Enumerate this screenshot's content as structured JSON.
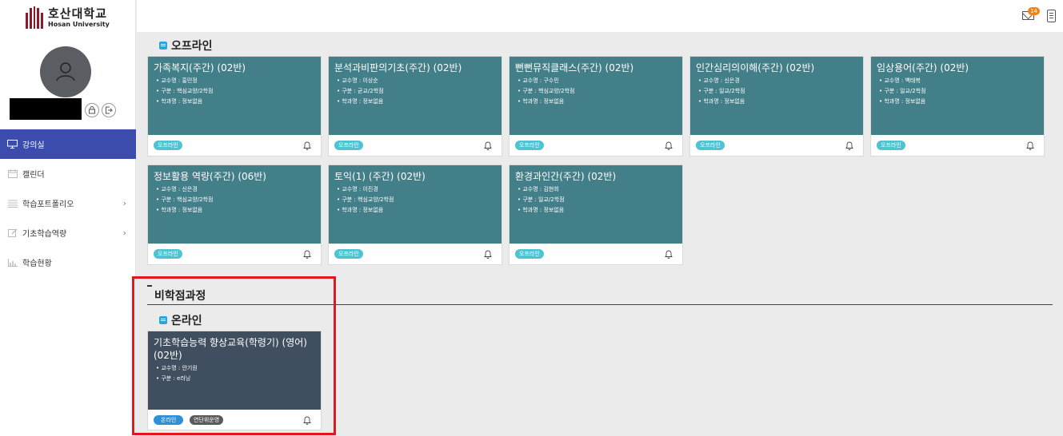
{
  "logo": {
    "name_ko": "호산대학교",
    "name_en": "Hosan University"
  },
  "sidebar": {
    "items": [
      {
        "label": "강의실",
        "icon": "monitor-icon",
        "active": true
      },
      {
        "label": "캘린더",
        "icon": "calendar-icon"
      },
      {
        "label": "학습포트폴리오",
        "icon": "list-icon",
        "chevron": true
      },
      {
        "label": "기초학습역량",
        "icon": "edit-icon",
        "chevron": true
      },
      {
        "label": "학습현황",
        "icon": "bar-chart-icon"
      }
    ]
  },
  "topbar": {
    "mail_badge": "14"
  },
  "offline_section": {
    "title": "오프라인"
  },
  "courses": [
    {
      "title": "가족복지(주간) (02반)",
      "info": [
        "교수명 : 홍민정",
        "구분 : 핵심교양/2학점",
        "학과명 : 정보없음"
      ],
      "tag": "오프라인"
    },
    {
      "title": "분석과비판의기초(주간) (02반)",
      "info": [
        "교수명 : 이상순",
        "구분 : 균교/2학점",
        "학과명 : 정보없음"
      ],
      "tag": "오프라인"
    },
    {
      "title": "뻔뻔뮤직클래스(주간) (02반)",
      "info": [
        "교수명 : 구수민",
        "구분 : 핵심교양/2학점",
        "학과명 : 정보없음"
      ],
      "tag": "오프라인"
    },
    {
      "title": "인간심리의이해(주간) (02반)",
      "info": [
        "교수명 : 신은경",
        "구분 : 일교/2학점",
        "학과명 : 정보없음"
      ],
      "tag": "오프라인"
    },
    {
      "title": "임상용어(주간) (02반)",
      "info": [
        "교수명 : 백태복",
        "구분 : 일교/2학점",
        "학과명 : 정보없음"
      ],
      "tag": "오프라인"
    },
    {
      "title": "정보활용 역량(주간) (06반)",
      "info": [
        "교수명 : 신은경",
        "구분 : 핵심교양/2학점",
        "학과명 : 정보없음"
      ],
      "tag": "오프라인"
    },
    {
      "title": "토익(1) (주간) (02반)",
      "info": [
        "교수명 : 이진경",
        "구분 : 핵심교양/2학점",
        "학과명 : 정보없음"
      ],
      "tag": "오프라인"
    },
    {
      "title": "환경과인간(주간) (02반)",
      "info": [
        "교수명 : 김현희",
        "구분 : 일교/2학점",
        "학과명 : 정보없음"
      ],
      "tag": "오프라인"
    }
  ],
  "non_credit": {
    "title": "비학점과정",
    "online_title": "온라인",
    "course": {
      "title_line1": "기초학습능력 향상교육(학령기) (영어)",
      "title_line2": "(02반)",
      "info": [
        "교수명 : 안기원",
        "구분 : e러닝"
      ],
      "tag_online": "온라인",
      "tag_extra": "연단위운영"
    }
  }
}
